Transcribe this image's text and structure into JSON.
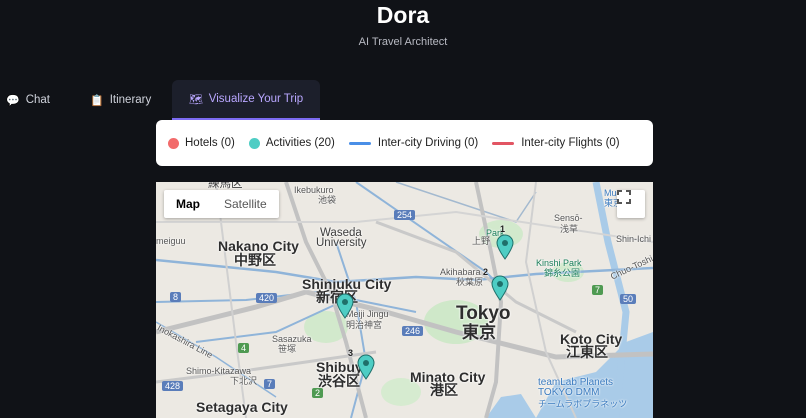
{
  "app": {
    "title": "Dora",
    "subtitle": "AI Travel Architect"
  },
  "tabs": [
    {
      "label": "Chat",
      "icon": "speech-bubble-icon",
      "icon_glyph": "💬",
      "active": false
    },
    {
      "label": "Itinerary",
      "icon": "clipboard-icon",
      "icon_glyph": "📋",
      "active": false
    },
    {
      "label": "Visualize Your Trip",
      "icon": "map-icon",
      "icon_glyph": "🗺",
      "active": true
    }
  ],
  "legend": [
    {
      "label": "Hotels (0)",
      "kind": "dot",
      "color": "#f26b6b"
    },
    {
      "label": "Activities (20)",
      "kind": "dot",
      "color": "#4ecdc4"
    },
    {
      "label": "Inter-city Driving (0)",
      "kind": "line",
      "color": "#4a8fe7"
    },
    {
      "label": "Inter-city Flights (0)",
      "kind": "line",
      "color": "#e25563"
    }
  ],
  "map": {
    "map_button": "Map",
    "satellite_button": "Satellite",
    "labels": {
      "nerima": "練馬区",
      "ikebukuro": "Ikebukuro",
      "ikebukuro_jp": "池袋",
      "waseda": "Waseda",
      "waseda_univ": "University",
      "nakano_city": "Nakano City",
      "nakano_jp": "中野区",
      "meiguu": "meiguu",
      "shinjuku_city": "Shinjuku City",
      "shinjuku_jp": "新宿区",
      "meiji_jingu": "Meiji Jingu",
      "meiji_jingu_jp": "明治神宮",
      "sasazuka": "Sasazuka",
      "sasazuka_jp": "笹塚",
      "inokashira": "Inokashira Line",
      "shimo_kitazawa": "Shimo-Kitazawa",
      "shimo_kitazawa_jp": "下北沢",
      "shibuya": "Shibuy",
      "shibuya_jp": "渋谷区",
      "setagaya": "Setagaya City",
      "akihabara": "Akihabara",
      "akihabara_jp": "秋葉原",
      "tokyo": "Tokyo",
      "tokyo_jp": "東京",
      "minato": "Minato City",
      "minato_jp": "港区",
      "koto": "Koto City",
      "koto_jp": "江東区",
      "kinshi": "Kinshi Park",
      "kinshi_jp": "錦糸公園",
      "ueno_park": "Park",
      "ueno_jp": "上野",
      "senso": "Sensō-",
      "senso_jp": "浅草",
      "shin_ichi": "Shin-Ichi",
      "chuo": "Chuo-Toshi",
      "museum": "Museum",
      "museum_jp": "東京",
      "teamlab": "teamLab Planets",
      "teamlab2": "TOKYO DMM",
      "teamlab_jp": "チームラボプラネッツ"
    },
    "road_numbers": [
      "254",
      "8",
      "420",
      "4",
      "246",
      "428",
      "7",
      "7",
      "50",
      "2"
    ],
    "pin_numbers": [
      "2",
      "3",
      "1"
    ]
  }
}
